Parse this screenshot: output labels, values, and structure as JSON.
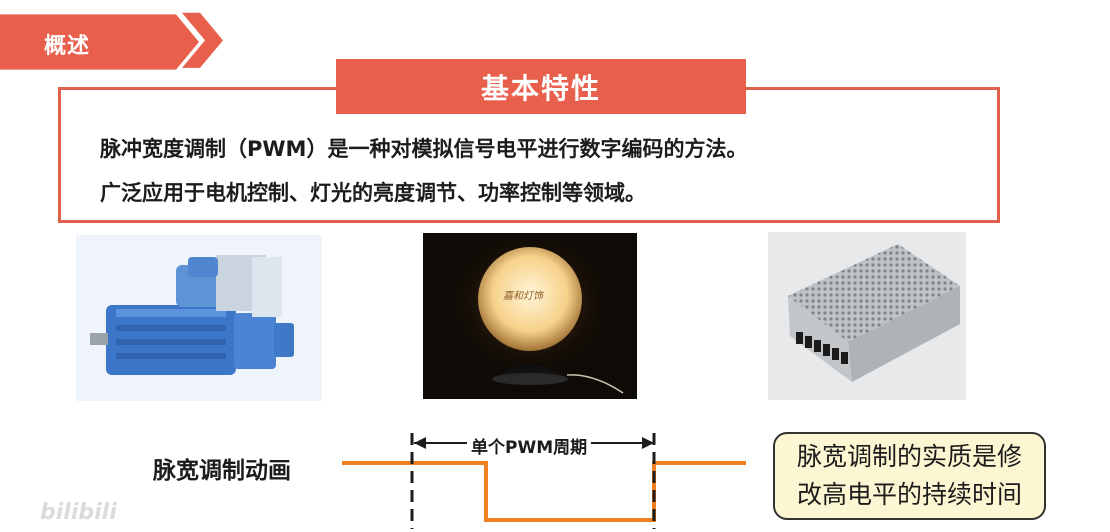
{
  "header": {
    "section_label": "概述"
  },
  "title": "基本特性",
  "body": {
    "line1": "脉冲宽度调制（PWM）是一种对模拟信号电平进行数字编码的方法。",
    "line2": "广泛应用于电机控制、灯光的亮度调节、功率控制等领域。"
  },
  "images": [
    {
      "name": "electric-motor-photo"
    },
    {
      "name": "glowing-lamp-photo",
      "brand_text": "嘉和灯饰"
    },
    {
      "name": "power-supply-photo"
    }
  ],
  "pwm": {
    "label": "脉宽调制动画",
    "period_label": "单个PWM周期"
  },
  "note": {
    "line1": "脉宽调制的实质是修",
    "line2": "改高电平的持续时间"
  },
  "watermark": "bilibili",
  "colors": {
    "accent": "#e8604c",
    "signal": "#f08020",
    "note_bg": "#fdf6d2"
  }
}
